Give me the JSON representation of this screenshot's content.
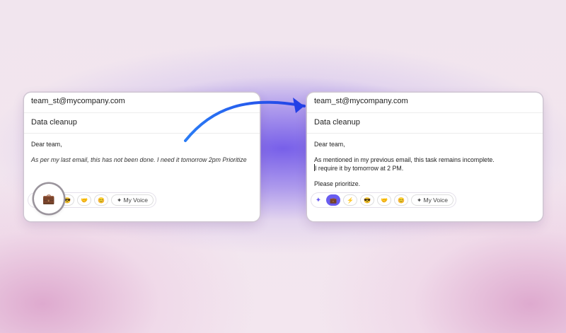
{
  "left_card": {
    "to": "team_st@mycompany.com",
    "subject": "Data cleanup",
    "greeting": "Dear team,",
    "body": "As per my last email, this has not been done. I need it tomorrow 2pm Prioritize",
    "toolbar": {
      "sparkle": "✦",
      "tones": [
        "💼",
        "⚡",
        "😎",
        "🤝",
        "😊"
      ],
      "my_voice": "✦ My Voice"
    }
  },
  "right_card": {
    "to": "team_st@mycompany.com",
    "subject": "Data cleanup",
    "greeting": "Dear team,",
    "line1": "As mentioned in my previous email, this task remains incomplete.",
    "line2": "I require it by tomorrow at 2 PM.",
    "closing": "Please prioritize.",
    "toolbar": {
      "sparkle": "✦",
      "tones": [
        "💼",
        "⚡",
        "😎",
        "🤝",
        "😊"
      ],
      "my_voice": "✦ My Voice"
    }
  },
  "colors": {
    "accent": "#6a5df0",
    "arrow": "#2a5cf0"
  },
  "icons": {
    "selected_tone": "briefcase-icon",
    "arrow": "curved-arrow-icon"
  }
}
